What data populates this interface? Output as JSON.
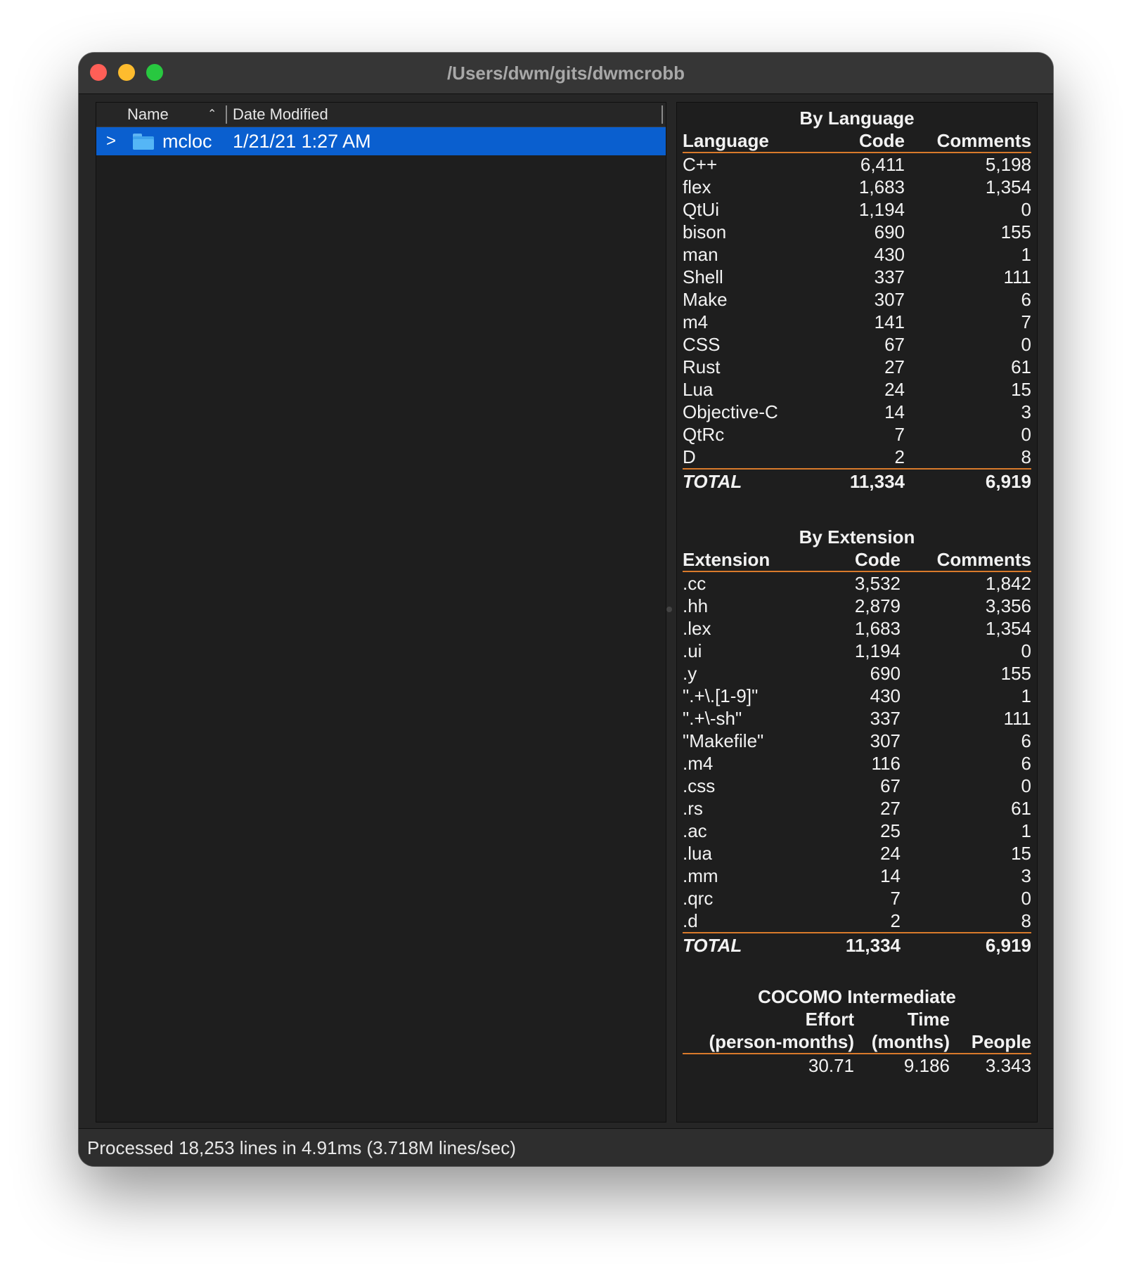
{
  "window": {
    "title": "/Users/dwm/gits/dwmcrobb"
  },
  "browser": {
    "columns": {
      "name": "Name",
      "date": "Date Modified"
    },
    "rows": [
      {
        "name": "mcloc",
        "date": "1/21/21 1:27 AM",
        "selected": true
      }
    ]
  },
  "stats": {
    "by_language": {
      "title": "By Language",
      "headers": [
        "Language",
        "Code",
        "Comments"
      ],
      "rows": [
        [
          "C++",
          "6,411",
          "5,198"
        ],
        [
          "flex",
          "1,683",
          "1,354"
        ],
        [
          "QtUi",
          "1,194",
          "0"
        ],
        [
          "bison",
          "690",
          "155"
        ],
        [
          "man",
          "430",
          "1"
        ],
        [
          "Shell",
          "337",
          "111"
        ],
        [
          "Make",
          "307",
          "6"
        ],
        [
          "m4",
          "141",
          "7"
        ],
        [
          "CSS",
          "67",
          "0"
        ],
        [
          "Rust",
          "27",
          "61"
        ],
        [
          "Lua",
          "24",
          "15"
        ],
        [
          "Objective-C",
          "14",
          "3"
        ],
        [
          "QtRc",
          "7",
          "0"
        ],
        [
          "D",
          "2",
          "8"
        ]
      ],
      "total": [
        "TOTAL",
        "11,334",
        "6,919"
      ]
    },
    "by_extension": {
      "title": "By Extension",
      "headers": [
        "Extension",
        "Code",
        "Comments"
      ],
      "rows": [
        [
          ".cc",
          "3,532",
          "1,842"
        ],
        [
          ".hh",
          "2,879",
          "3,356"
        ],
        [
          ".lex",
          "1,683",
          "1,354"
        ],
        [
          ".ui",
          "1,194",
          "0"
        ],
        [
          ".y",
          "690",
          "155"
        ],
        [
          "\".+\\.[1-9]\"",
          "430",
          "1"
        ],
        [
          "\".+\\-sh\"",
          "337",
          "111"
        ],
        [
          "\"Makefile\"",
          "307",
          "6"
        ],
        [
          ".m4",
          "116",
          "6"
        ],
        [
          ".css",
          "67",
          "0"
        ],
        [
          ".rs",
          "27",
          "61"
        ],
        [
          ".ac",
          "25",
          "1"
        ],
        [
          ".lua",
          "24",
          "15"
        ],
        [
          ".mm",
          "14",
          "3"
        ],
        [
          ".qrc",
          "7",
          "0"
        ],
        [
          ".d",
          "2",
          "8"
        ]
      ],
      "total": [
        "TOTAL",
        "11,334",
        "6,919"
      ]
    },
    "cocomo": {
      "title": "COCOMO Intermediate",
      "effort_label": "Effort",
      "effort_unit": "(person-months)",
      "time_label": "Time",
      "time_unit": "(months)",
      "people_label": "People",
      "effort": "30.71",
      "time": "9.186",
      "people": "3.343"
    }
  },
  "status": {
    "text": "Processed 18,253 lines in 4.91ms (3.718M lines/sec)"
  },
  "colors": {
    "selection": "#0a5fcf",
    "rule": "#d97a2b"
  }
}
